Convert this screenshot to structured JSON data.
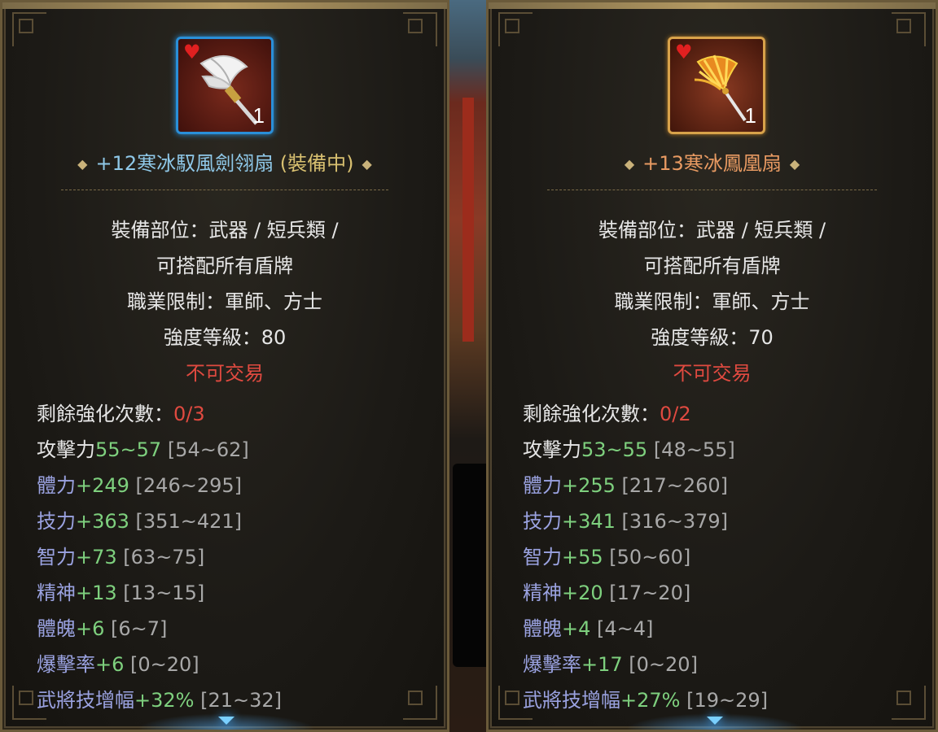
{
  "left_item": {
    "quantity": "1",
    "name": "+12寒冰馭風劍翎扇",
    "equipped": "(裝備中)",
    "slot_line1": "裝備部位：武器 / 短兵類 /",
    "slot_line2": "可搭配所有盾牌",
    "class_restrict": "職業限制：軍師、方士",
    "enhance_level": "強度等級：80",
    "trade": "不可交易",
    "remaining_label": "剩餘強化次數：",
    "remaining_value": "0/3",
    "stats": [
      {
        "label": "攻擊力",
        "value": "55~57",
        "range": " [54~62]"
      },
      {
        "label": "體力",
        "value": "+249",
        "range": " [246~295]"
      },
      {
        "label": "技力",
        "value": "+363",
        "range": " [351~421]"
      },
      {
        "label": "智力",
        "value": "+73",
        "range": " [63~75]"
      },
      {
        "label": "精神",
        "value": "+13",
        "range": " [13~15]"
      },
      {
        "label": "體魄",
        "value": "+6",
        "range": " [6~7]"
      },
      {
        "label": "爆擊率",
        "value": "+6",
        "range": " [0~20]"
      },
      {
        "label": "武將技增幅",
        "value": "+32%",
        "range": " [21~32]"
      }
    ]
  },
  "right_item": {
    "quantity": "1",
    "name": "+13寒冰鳳凰扇",
    "slot_line1": "裝備部位：武器 / 短兵類 /",
    "slot_line2": "可搭配所有盾牌",
    "class_restrict": "職業限制：軍師、方士",
    "enhance_level": "強度等級：70",
    "trade": "不可交易",
    "remaining_label": "剩餘強化次數：",
    "remaining_value": "0/2",
    "stats": [
      {
        "label": "攻擊力",
        "value": "53~55",
        "range": " [48~55]"
      },
      {
        "label": "體力",
        "value": "+255",
        "range": " [217~260]"
      },
      {
        "label": "技力",
        "value": "+341",
        "range": " [316~379]"
      },
      {
        "label": "智力",
        "value": "+55",
        "range": " [50~60]"
      },
      {
        "label": "精神",
        "value": "+20",
        "range": " [17~20]"
      },
      {
        "label": "體魄",
        "value": "+4",
        "range": " [4~4]"
      },
      {
        "label": "爆擊率",
        "value": "+17",
        "range": " [0~20]"
      },
      {
        "label": "武將技增幅",
        "value": "+27%",
        "range": " [19~29]"
      }
    ]
  },
  "colors": {
    "name_equipped": "#8fc8e8",
    "name_other": "#e89a62",
    "positive_value": "#7ed07e",
    "warning": "#e04a40",
    "range": "#a8a8a8"
  },
  "icons": {
    "left_item_icon": "white-feather-fan-icon",
    "right_item_icon": "golden-phoenix-fan-icon",
    "favorite": "heart-icon",
    "scroll_more": "chevron-down-icon"
  }
}
